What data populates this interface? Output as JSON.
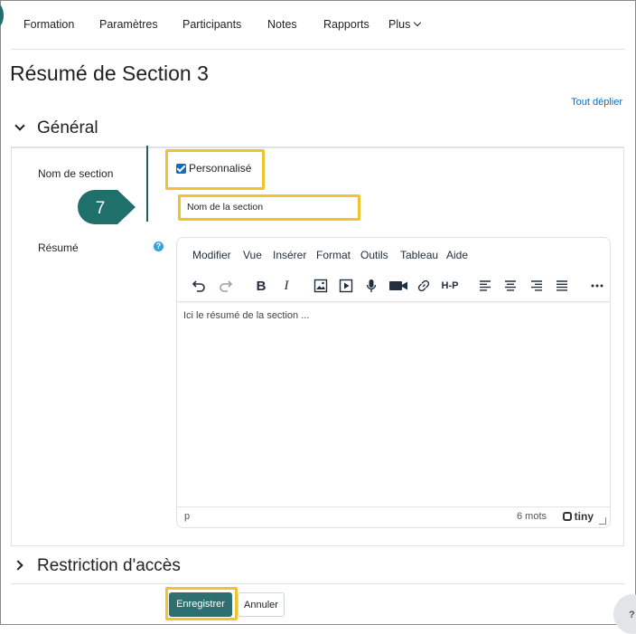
{
  "nav": {
    "items": [
      "Formation",
      "Paramètres",
      "Participants",
      "Notes",
      "Rapports"
    ],
    "more_label": "Plus"
  },
  "page_title": "Résumé de Section 3",
  "expand_all_label": "Tout déplier",
  "general_section": {
    "title": "Général",
    "section_name_label": "Nom de section",
    "custom_checkbox_label": "Personnalisé",
    "custom_checked": true,
    "section_name_value": "Nom de la section",
    "summary_label": "Résumé"
  },
  "step_badge": "7",
  "editor": {
    "menu": [
      "Modifier",
      "Vue",
      "Insérer",
      "Format",
      "Outils",
      "Tableau",
      "Aide"
    ],
    "content_text": "Ici le résumé de la section ...",
    "status_path": "p",
    "word_count": "6 mots",
    "brand": "tiny",
    "h5p_label": "H-P"
  },
  "restriction_section": {
    "title": "Restriction d'accès"
  },
  "buttons": {
    "save": "Enregistrer",
    "cancel": "Annuler"
  },
  "help_float_label": "?",
  "colors": {
    "primary": "#2e7070",
    "highlight": "#f0c330",
    "badge": "#1f6f6b",
    "link": "#0f6cbf"
  }
}
